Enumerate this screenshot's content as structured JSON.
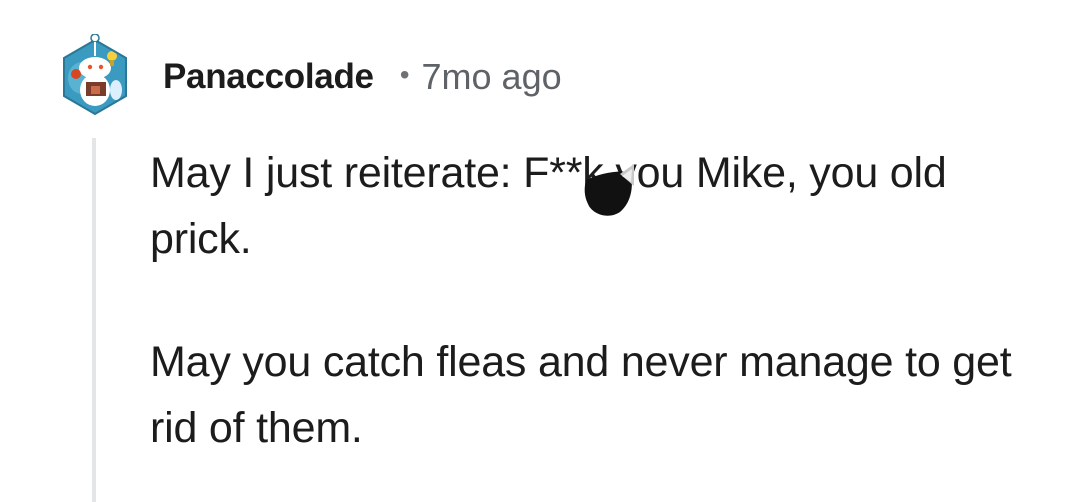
{
  "comment": {
    "username": "Panaccolade",
    "separator": "•",
    "timestamp": "7mo ago",
    "avatar_icon": "snoo-avatar-icon",
    "paragraphs": [
      "May I just reiterate: F**k you Mike, you old prick.",
      "May you catch fleas and never manage to get rid of them."
    ]
  },
  "colors": {
    "text": "#1c1c1c",
    "muted": "#5f6266",
    "thread_line": "#e4e5e7",
    "avatar_bg": "#2a86a8"
  }
}
